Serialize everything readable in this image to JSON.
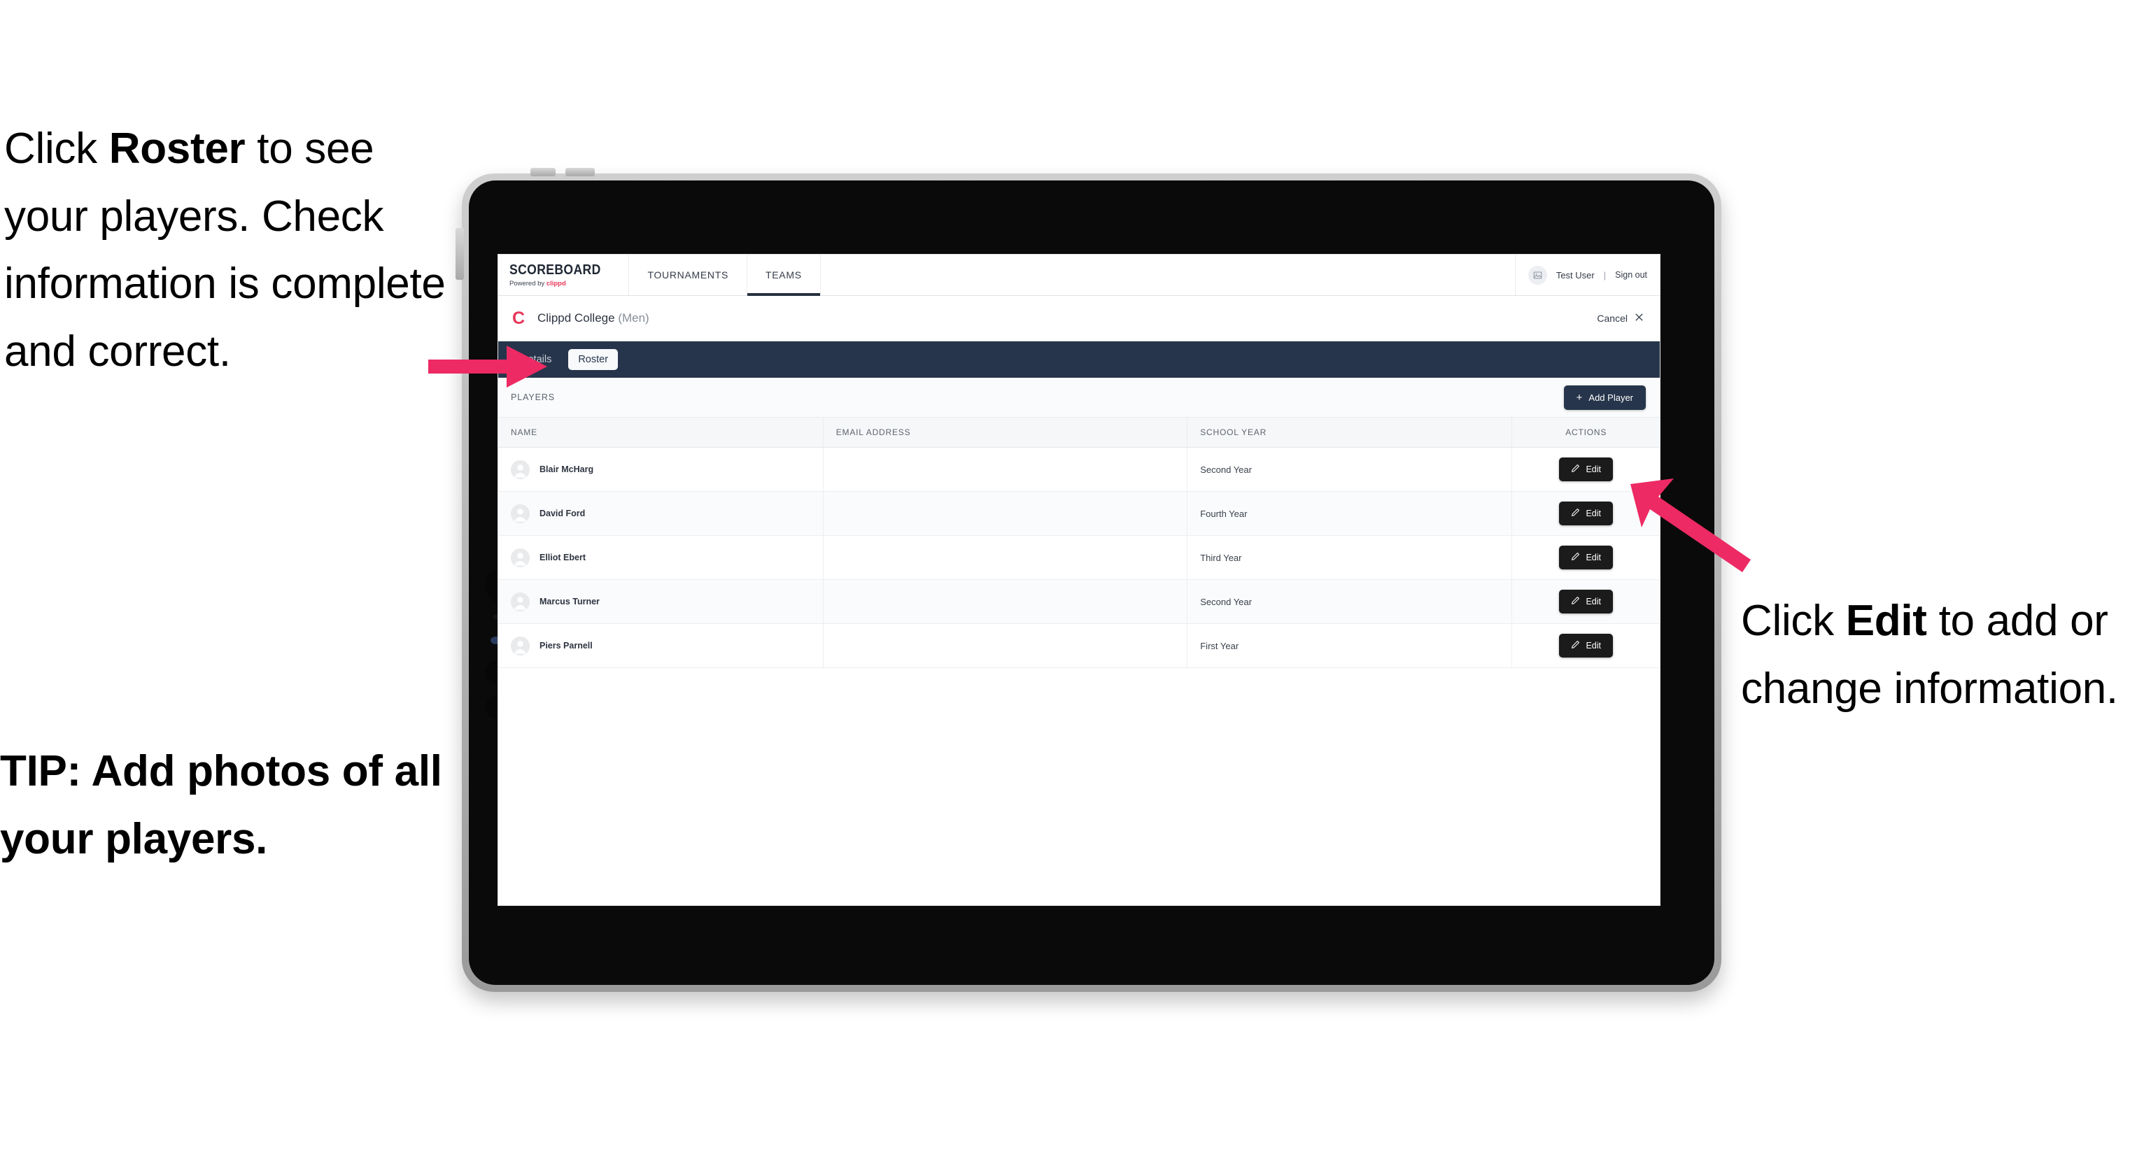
{
  "annotations": {
    "left": {
      "prefix": "Click ",
      "bold": "Roster",
      "suffix": " to see your players. Check information is complete and correct."
    },
    "tip": "TIP: Add photos of all your players.",
    "right": {
      "prefix": "Click ",
      "bold": "Edit",
      "suffix": " to add or change information."
    }
  },
  "app": {
    "brand": {
      "name": "SCOREBOARD",
      "powered_prefix": "Powered by ",
      "powered_brand": "clippd"
    },
    "nav": [
      {
        "label": "TOURNAMENTS",
        "active": false
      },
      {
        "label": "TEAMS",
        "active": true
      }
    ],
    "user": {
      "name": "Test User",
      "separator": "|",
      "sign_out": "Sign out",
      "avatar_icon": "user-photo-icon"
    },
    "team_header": {
      "logo_letter": "C",
      "name": "Clippd College",
      "gender": "(Men)",
      "cancel_label": "Cancel",
      "cancel_icon": "close-x-icon"
    },
    "subtabs": [
      {
        "label": "Details",
        "active": false
      },
      {
        "label": "Roster",
        "active": true
      }
    ],
    "players_section": {
      "label": "PLAYERS",
      "add_button": {
        "plus": "+",
        "label": "Add Player"
      }
    },
    "table": {
      "columns": [
        "NAME",
        "EMAIL ADDRESS",
        "SCHOOL YEAR",
        "ACTIONS"
      ],
      "rows": [
        {
          "name": "Blair McHarg",
          "email": "",
          "school_year": "Second Year",
          "action": "Edit"
        },
        {
          "name": "David Ford",
          "email": "",
          "school_year": "Fourth Year",
          "action": "Edit"
        },
        {
          "name": "Elliot Ebert",
          "email": "",
          "school_year": "Third Year",
          "action": "Edit"
        },
        {
          "name": "Marcus Turner",
          "email": "",
          "school_year": "Second Year",
          "action": "Edit"
        },
        {
          "name": "Piers Parnell",
          "email": "",
          "school_year": "First Year",
          "action": "Edit"
        }
      ]
    }
  },
  "colors": {
    "accent_pink": "#ED2A63",
    "navy": "#26354B",
    "brand_red": "#E8375A",
    "dark_button": "#1B1B1B"
  }
}
